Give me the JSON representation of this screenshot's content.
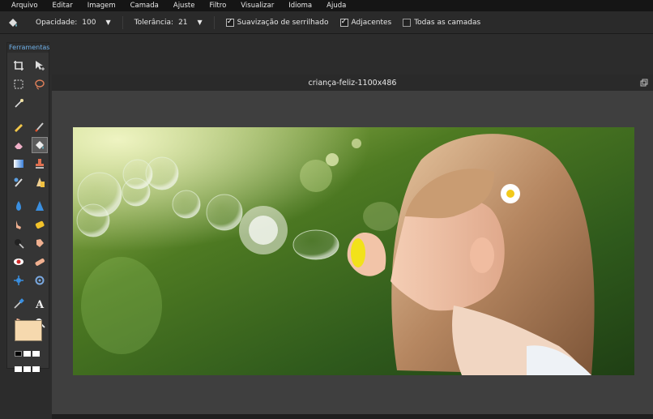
{
  "menu": [
    "Arquivo",
    "Editar",
    "Imagem",
    "Camada",
    "Ajuste",
    "Filtro",
    "Visualizar",
    "Idioma",
    "Ajuda"
  ],
  "options": {
    "opacity_label": "Opacidade:",
    "opacity_value": "100",
    "tolerance_label": "Tolerância:",
    "tolerance_value": "21",
    "antialias_label": "Suavização de serrilhado",
    "antialias_checked": true,
    "contiguous_label": "Adjacentes",
    "contiguous_checked": true,
    "all_layers_label": "Todas as camadas",
    "all_layers_checked": false
  },
  "toolbox": {
    "title": "Ferramentas",
    "tools": [
      [
        "crop-icon",
        "move-icon"
      ],
      [
        "marquee-icon",
        "lasso-icon"
      ],
      [
        "magic-wand-icon",
        ""
      ],
      [
        "pencil-icon",
        "brush-icon"
      ],
      [
        "eraser-icon",
        "paint-bucket-icon"
      ],
      [
        "gradient-icon",
        "clone-stamp-icon"
      ],
      [
        "color-replace-icon",
        "sharpen-icon"
      ],
      [
        "drop-icon",
        "triangle-icon"
      ],
      [
        "smudge-icon",
        "sponge-icon"
      ],
      [
        "burn-icon",
        "dodge-icon"
      ],
      [
        "red-eye-icon",
        "bandage-icon"
      ],
      [
        "bloat-icon",
        "pinch-icon"
      ],
      [
        "color-picker-icon",
        "text-icon"
      ],
      [
        "hand-icon",
        "zoom-icon"
      ]
    ],
    "selected": "paint-bucket-icon",
    "foreground_color": "#f6d9ae",
    "background_color": "#ffffff"
  },
  "document": {
    "title": "criança-feliz-1100x486"
  }
}
